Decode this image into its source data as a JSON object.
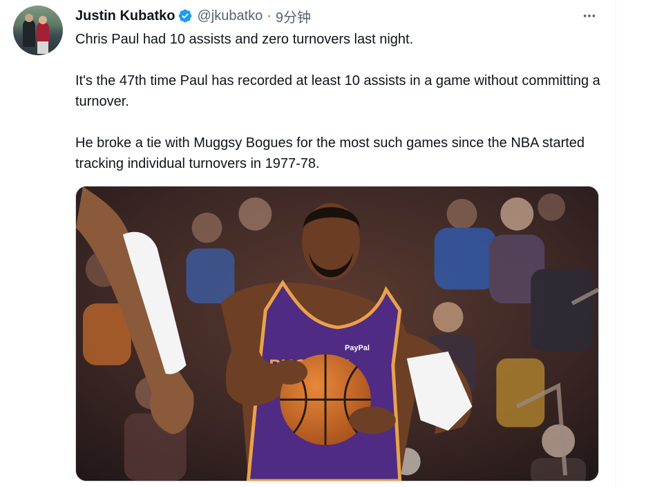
{
  "tweet": {
    "author_name": "Justin Kubatko",
    "handle": "@jkubatko",
    "separator": "·",
    "time": "9分钟",
    "paragraphs": [
      "Chris Paul had 10 assists and zero turnovers last night.",
      "It's the 47th time Paul has recorded at least 10 assists in a game without committing a turnover.",
      "He broke a tie with Muggsy Bogues for the most such games since the NBA started tracking individual turnovers in 1977-78."
    ],
    "media": {
      "jersey_text": "PHOENIX",
      "jersey_sponsor": "PayPal",
      "jersey_color": "#4f2b83",
      "jersey_trim": "#e9a24c"
    }
  },
  "icons": {
    "verified": "verified-badge-icon",
    "more": "more-horizontal-icon"
  },
  "colors": {
    "text_primary": "#0f1419",
    "text_secondary": "#536471",
    "verified_blue": "#1d9bf0",
    "border": "#cfd9de"
  }
}
